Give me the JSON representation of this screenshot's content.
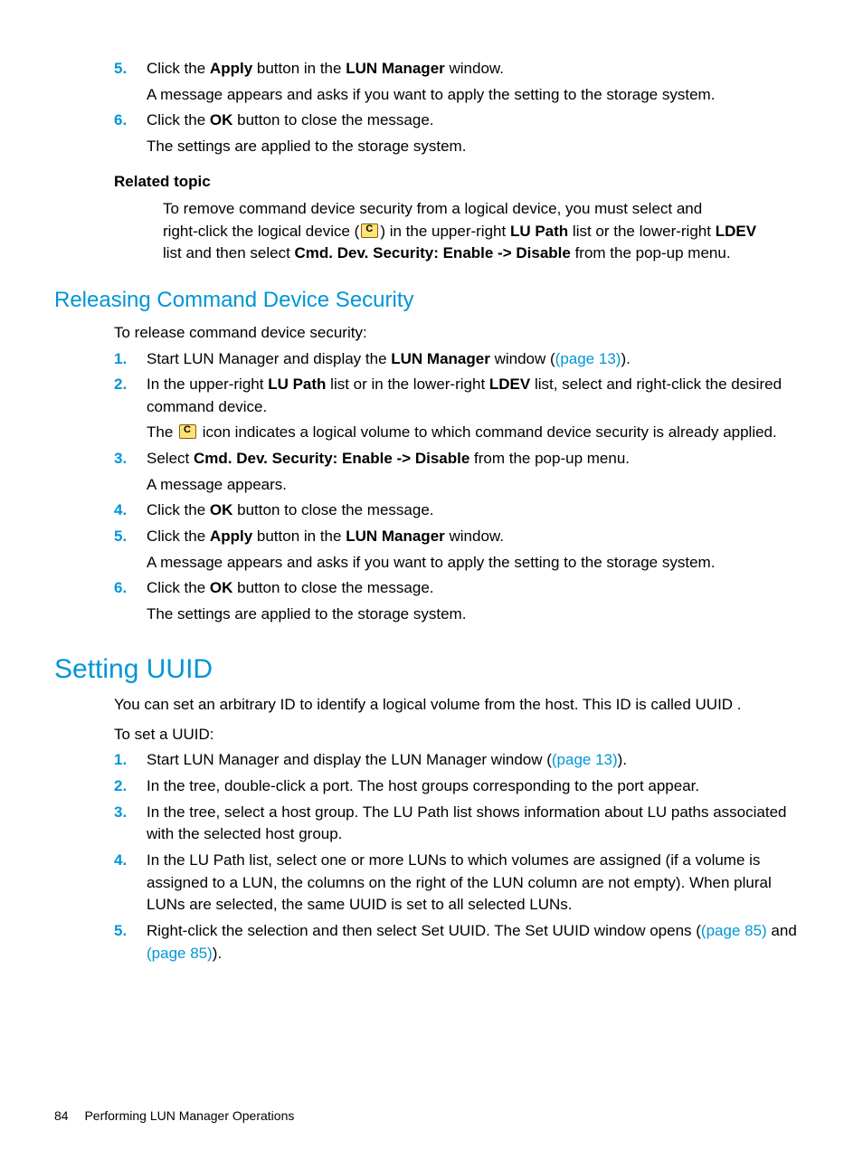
{
  "top_list": {
    "item5": {
      "num": "5.",
      "prefix": "Click the ",
      "b1": "Apply",
      "mid": " button in the ",
      "b2": "LUN Manager",
      "suffix": " window.",
      "sub": "A message appears and asks if you want to apply the setting to the storage system."
    },
    "item6": {
      "num": "6.",
      "prefix": "Click the ",
      "b1": "OK",
      "suffix": " button to close the message.",
      "sub": "The settings are applied to the storage system."
    }
  },
  "related": {
    "heading": "Related topic",
    "l1_a": "To remove command device security from a logical device, you must select and",
    "l2_a": "right-click the logical device (",
    "l2_b": ") in the upper-right ",
    "l2_bold1": "LU Path",
    "l2_c": " list or the lower-right ",
    "l3_bold1": "LDEV",
    "l3_a": " list and then select ",
    "l3_bold2": "Cmd. Dev. Security: Enable -> Disable",
    "l3_b": " from the pop-up menu."
  },
  "sec1": {
    "title": "Releasing Command Device Security",
    "intro": "To release command device security:",
    "i1": {
      "num": "1.",
      "a": "Start LUN Manager and display the ",
      "b1": "LUN Manager",
      "b": " window (",
      "link": "(page 13)",
      "c": ")."
    },
    "i2": {
      "num": "2.",
      "a": "In the upper-right ",
      "b1": "LU Path",
      "b": " list or in the lower-right ",
      "b2": "LDEV",
      "c": " list, select and right-click the desired command device.",
      "sub_a": "The ",
      "sub_b": " icon indicates a logical volume to which command device security is already applied."
    },
    "i3": {
      "num": "3.",
      "a": "Select ",
      "b1": "Cmd. Dev. Security: Enable -> Disable",
      "b": " from the pop-up menu.",
      "sub": "A message appears."
    },
    "i4": {
      "num": "4.",
      "a": "Click the ",
      "b1": "OK",
      "b": " button to close the message."
    },
    "i5": {
      "num": "5.",
      "a": "Click the ",
      "b1": "Apply",
      "b": " button in the ",
      "b2": "LUN Manager",
      "c": " window.",
      "sub": "A message appears and asks if you want to apply the setting to the storage system."
    },
    "i6": {
      "num": "6.",
      "a": "Click the ",
      "b1": "OK",
      "b": " button to close the message.",
      "sub": "The settings are applied to the storage system."
    }
  },
  "sec2": {
    "title": "Setting UUID",
    "intro1": "You can set an arbitrary ID to identify a logical volume from the host. This ID is called UUID .",
    "intro2": "To set a UUID:",
    "i1": {
      "num": "1.",
      "a": "Start LUN Manager and display the LUN Manager window (",
      "link": "(page 13)",
      "b": ")."
    },
    "i2": {
      "num": "2.",
      "a": "In the tree, double-click a port. The host groups corresponding to the port appear."
    },
    "i3": {
      "num": "3.",
      "a": "In the tree, select a host group. The LU Path list shows information about LU paths associated with the selected host group."
    },
    "i4": {
      "num": "4.",
      "a": "In the LU Path list, select one or more LUNs to which volumes are assigned (if a volume is assigned to a LUN, the columns on the right of the LUN column are not empty). When plural LUNs are selected, the same UUID is set to all selected LUNs."
    },
    "i5": {
      "num": "5.",
      "a": "Right-click the selection and then select Set UUID. The Set UUID window opens (",
      "link1": "(page 85)",
      "b": " and ",
      "link2": "(page 85)",
      "c": ")."
    }
  },
  "footer": {
    "page": "84",
    "title": "Performing LUN Manager Operations"
  }
}
